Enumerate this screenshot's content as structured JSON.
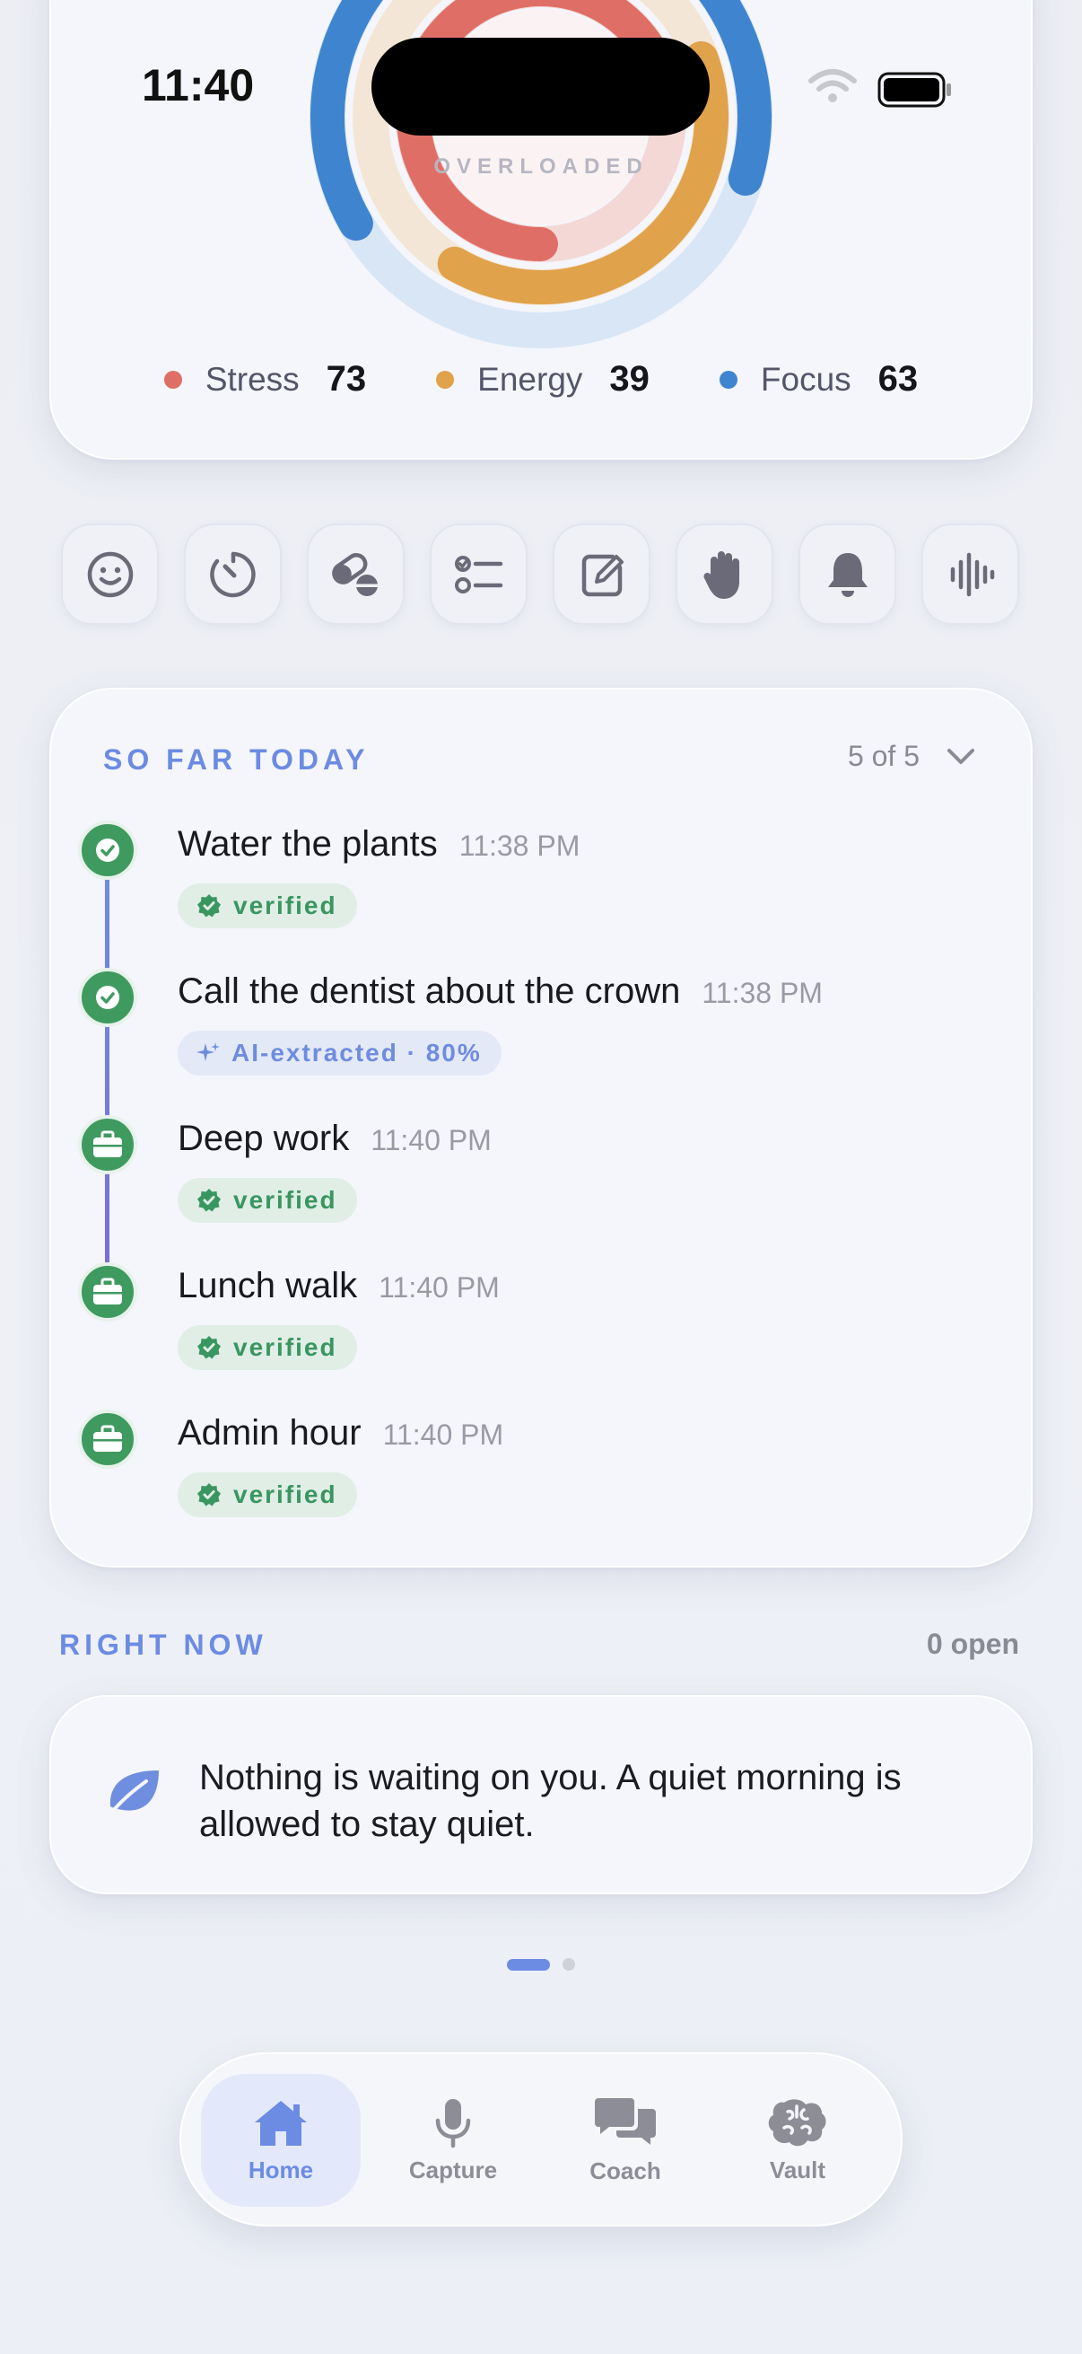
{
  "status_bar": {
    "time": "11:40"
  },
  "mood_ring": {
    "label": "OVERLOADED",
    "metrics": [
      {
        "name": "Stress",
        "value": 73,
        "color": "#df6f66"
      },
      {
        "name": "Energy",
        "value": 39,
        "color": "#e0a24a"
      },
      {
        "name": "Focus",
        "value": 63,
        "color": "#3f84cf"
      }
    ]
  },
  "quick_actions": [
    {
      "icon": "smiley-icon"
    },
    {
      "icon": "timer-icon"
    },
    {
      "icon": "pills-icon"
    },
    {
      "icon": "checklist-icon"
    },
    {
      "icon": "edit-icon"
    },
    {
      "icon": "hand-icon"
    },
    {
      "icon": "bell-icon"
    },
    {
      "icon": "voice-waveform-icon"
    }
  ],
  "today": {
    "title": "SO FAR TODAY",
    "count": "5 of 5",
    "items": [
      {
        "title": "Water the plants",
        "time": "11:38 PM",
        "badge": "verified",
        "badge_type": "green",
        "icon": "check"
      },
      {
        "title": "Call the dentist about the crown",
        "time": "11:38 PM",
        "badge": "AI-extracted · 80%",
        "badge_type": "blue",
        "icon": "check"
      },
      {
        "title": "Deep work",
        "time": "11:40 PM",
        "badge": "verified",
        "badge_type": "green",
        "icon": "briefcase"
      },
      {
        "title": "Lunch walk",
        "time": "11:40 PM",
        "badge": "verified",
        "badge_type": "green",
        "icon": "briefcase"
      },
      {
        "title": "Admin hour",
        "time": "11:40 PM",
        "badge": "verified",
        "badge_type": "green",
        "icon": "briefcase"
      }
    ]
  },
  "right_now": {
    "title": "RIGHT NOW",
    "count": "0 open",
    "message": "Nothing is waiting on you. A quiet morning is allowed to stay quiet."
  },
  "tabs": [
    {
      "label": "Home",
      "active": true
    },
    {
      "label": "Capture",
      "active": false
    },
    {
      "label": "Coach",
      "active": false
    },
    {
      "label": "Vault",
      "active": false
    }
  ],
  "colors": {
    "accent": "#6c8be3",
    "success": "#3f9a60"
  }
}
